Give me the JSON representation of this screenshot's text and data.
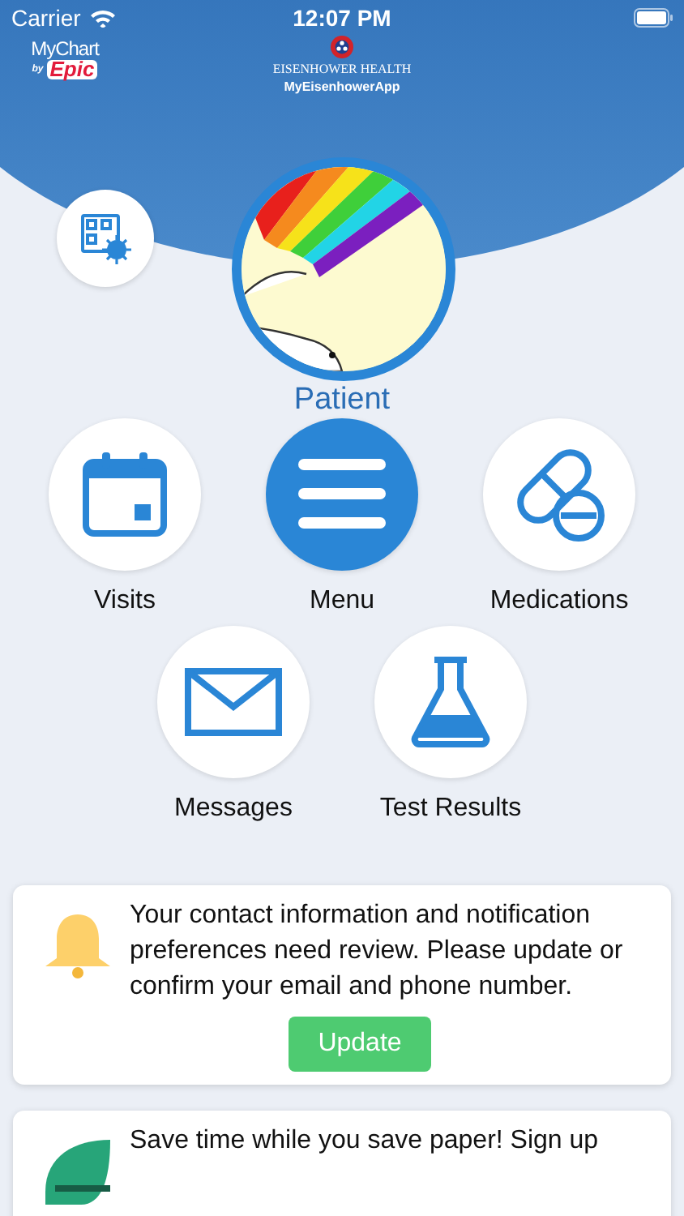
{
  "status_bar": {
    "carrier": "Carrier",
    "time": "12:07 PM"
  },
  "header": {
    "mychart_logo": "MyChart",
    "by": "by",
    "epic": "Epic",
    "org_name": "EISENHOWER HEALTH",
    "app_name": "MyEisenhowerApp"
  },
  "profile": {
    "name": "Patient"
  },
  "tiles": [
    {
      "kind": "calendar",
      "label": "Visits",
      "filled": false
    },
    {
      "kind": "menu",
      "label": "Menu",
      "filled": true
    },
    {
      "kind": "pill",
      "label": "Medications",
      "filled": false
    },
    {
      "kind": "envelope",
      "label": "Messages",
      "filled": false
    },
    {
      "kind": "flask",
      "label": "Test Results",
      "filled": false
    }
  ],
  "cards": [
    {
      "kind": "bell",
      "text": "Your contact information and notification preferences need review. Please update or confirm your email and phone number.",
      "button": "Update"
    },
    {
      "kind": "leaf",
      "text": "Save time while you save paper! Sign up"
    }
  ]
}
